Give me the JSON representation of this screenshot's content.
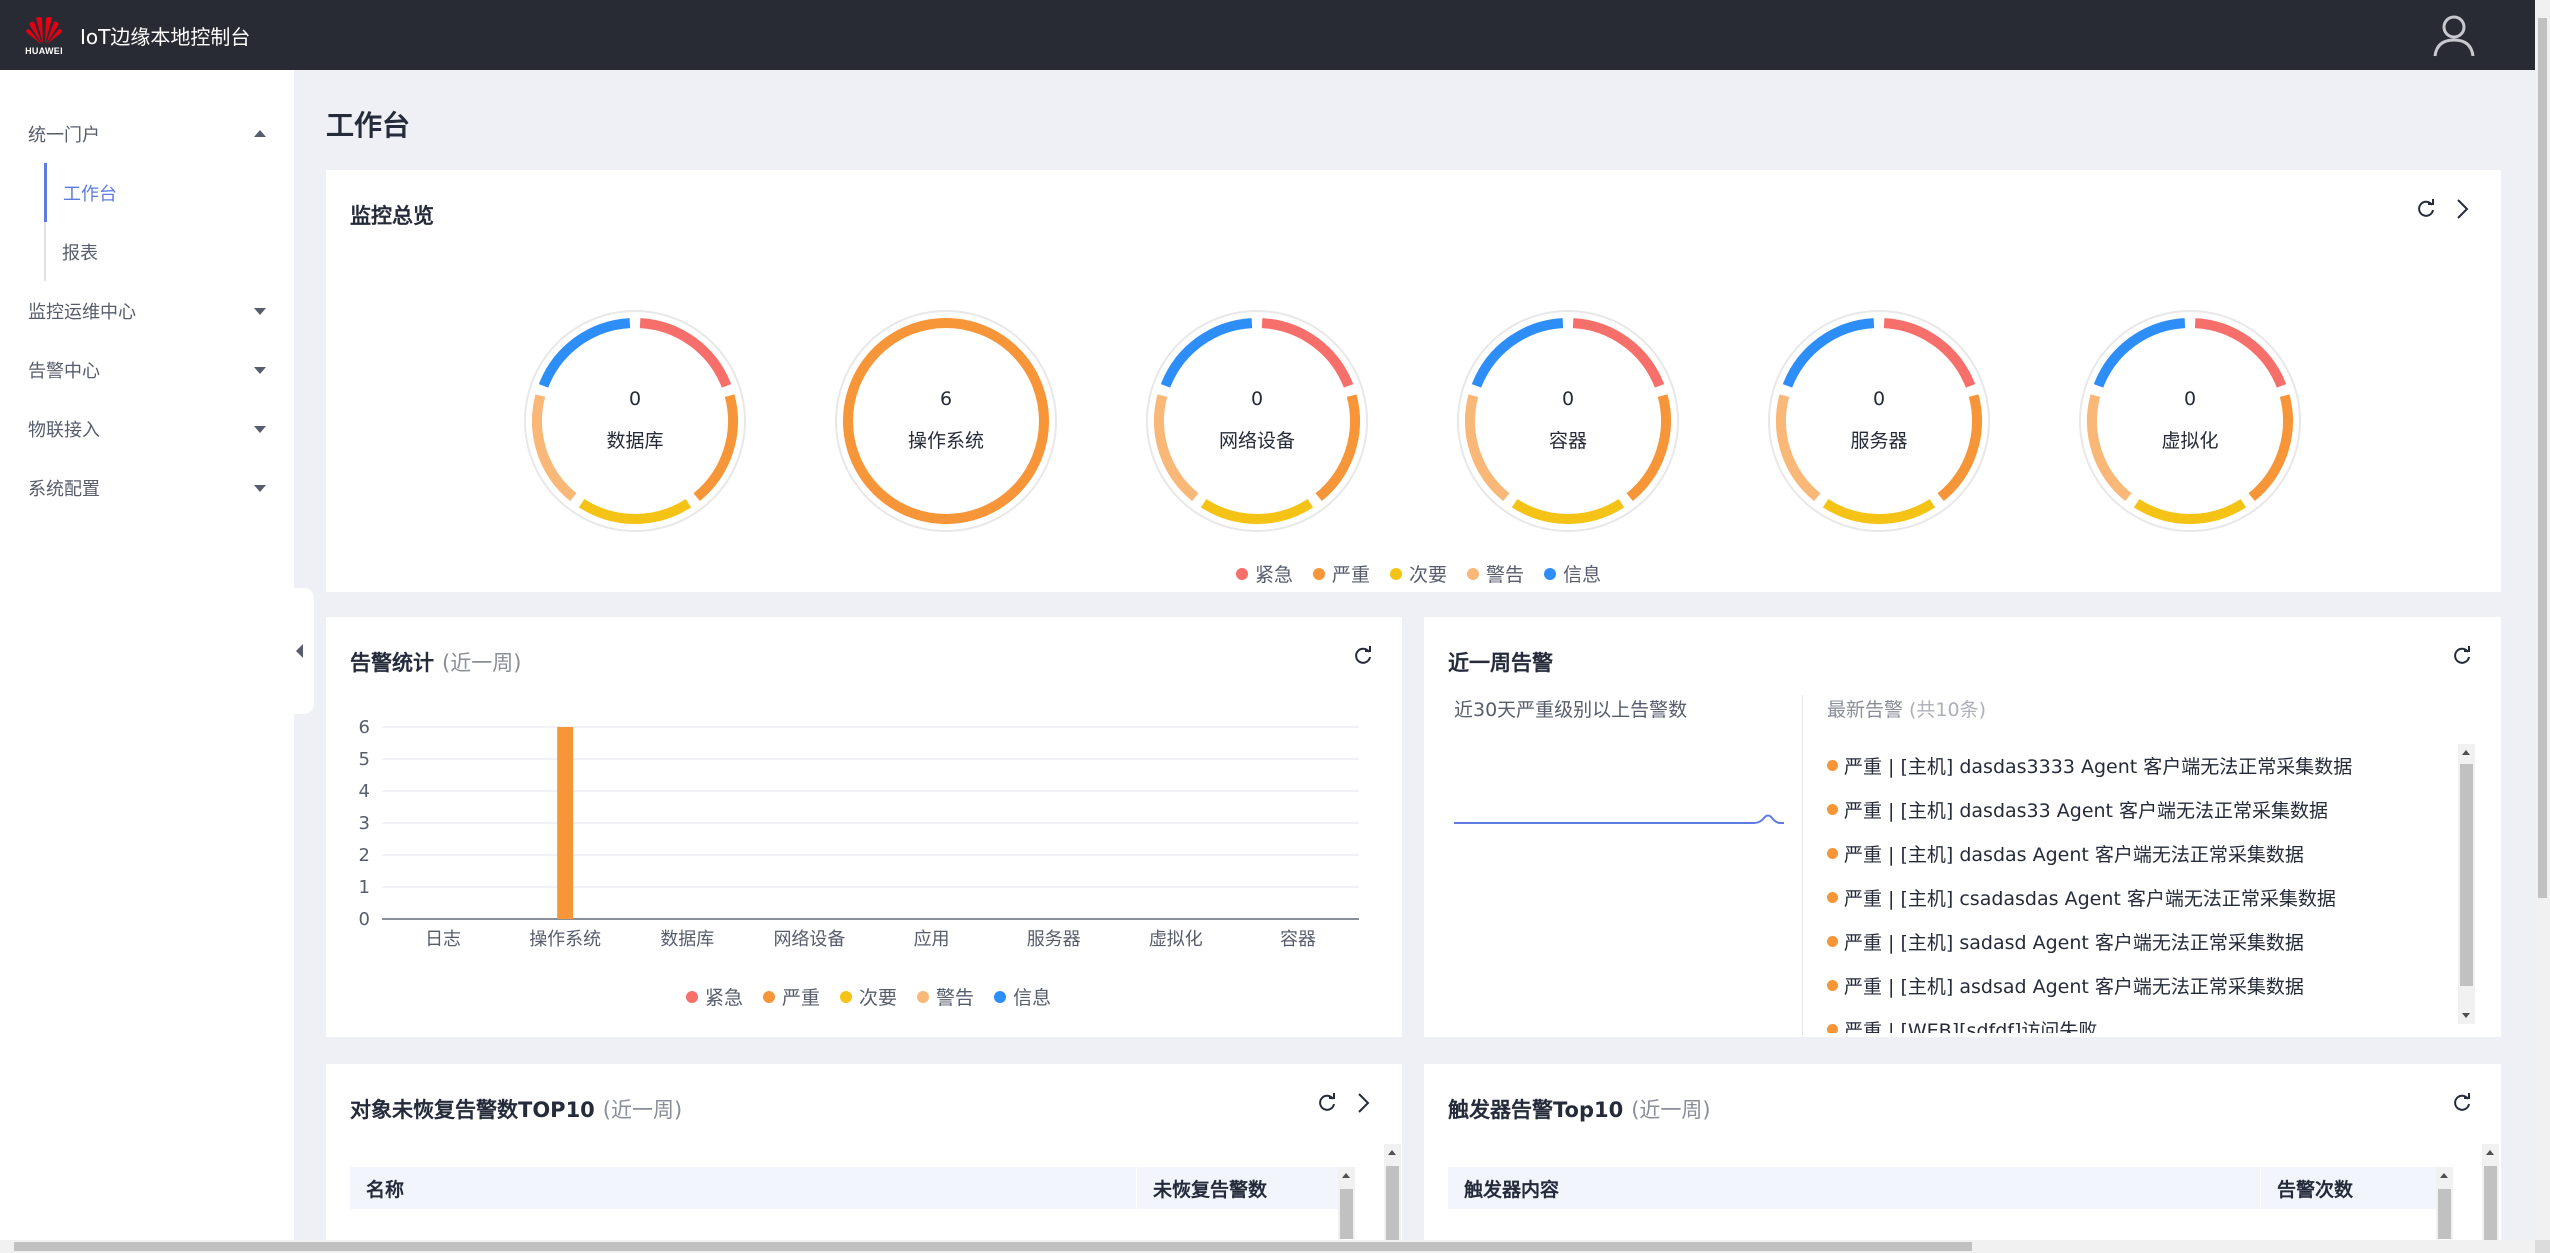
{
  "header": {
    "logo_text": "HUAWEI",
    "app_title": "IoT边缘本地控制台",
    "user_icon": "user-icon"
  },
  "sidebar": {
    "groups": [
      {
        "label": "统一门户",
        "expanded": true,
        "items": [
          {
            "label": "工作台",
            "active": true
          },
          {
            "label": "报表",
            "active": false
          }
        ]
      },
      {
        "label": "监控运维中心",
        "expanded": false
      },
      {
        "label": "告警中心",
        "expanded": false
      },
      {
        "label": "物联接入",
        "expanded": false
      },
      {
        "label": "系统配置",
        "expanded": false
      }
    ]
  },
  "page": {
    "title": "工作台"
  },
  "colors": {
    "urgent": "#f66f6a",
    "severe": "#f79539",
    "minor": "#f5c316",
    "warning": "#f9b778",
    "info": "#2e8ef7",
    "accent": "#5e7ce0",
    "bar": "#f79539"
  },
  "severity_legend": [
    "紧急",
    "严重",
    "次要",
    "警告",
    "信息"
  ],
  "monitor_overview": {
    "title": "监控总览",
    "donuts": [
      {
        "value": "0",
        "label": "数据库",
        "mode": "empty"
      },
      {
        "value": "6",
        "label": "操作系统",
        "mode": "severe"
      },
      {
        "value": "0",
        "label": "网络设备",
        "mode": "empty"
      },
      {
        "value": "0",
        "label": "容器",
        "mode": "empty"
      },
      {
        "value": "0",
        "label": "服务器",
        "mode": "empty"
      },
      {
        "value": "0",
        "label": "虚拟化",
        "mode": "empty"
      }
    ]
  },
  "alarm_stats": {
    "title": "告警统计",
    "subtitle": "(近一周)"
  },
  "chart_data": {
    "type": "bar",
    "categories": [
      "日志",
      "操作系统",
      "数据库",
      "网络设备",
      "应用",
      "服务器",
      "虚拟化",
      "容器"
    ],
    "series": [
      {
        "name": "紧急",
        "values": [
          0,
          0,
          0,
          0,
          0,
          0,
          0,
          0
        ]
      },
      {
        "name": "严重",
        "values": [
          0,
          6,
          0,
          0,
          0,
          0,
          0,
          0
        ]
      },
      {
        "name": "次要",
        "values": [
          0,
          0,
          0,
          0,
          0,
          0,
          0,
          0
        ]
      },
      {
        "name": "警告",
        "values": [
          0,
          0,
          0,
          0,
          0,
          0,
          0,
          0
        ]
      },
      {
        "name": "信息",
        "values": [
          0,
          0,
          0,
          0,
          0,
          0,
          0,
          0
        ]
      }
    ],
    "yticks": [
      0,
      1,
      2,
      3,
      4,
      5,
      6
    ],
    "ylim": [
      0,
      6
    ],
    "grid": true,
    "legend": "bottom"
  },
  "recent_week": {
    "title": "近一周告警",
    "left_label": "近30天严重级别以上告警数",
    "latest_label": "最新告警",
    "latest_count": "(共10条)",
    "alarms": [
      "严重 | [主机] dasdas3333 Agent 客户端无法正常采集数据",
      "严重 | [主机] dasdas33 Agent 客户端无法正常采集数据",
      "严重 | [主机] dasdas Agent 客户端无法正常采集数据",
      "严重 | [主机] csadasdas Agent 客户端无法正常采集数据",
      "严重 | [主机] sadasd Agent 客户端无法正常采集数据",
      "严重 | [主机] asdsad Agent 客户端无法正常采集数据",
      "严重 | [WEB][sdfdf]访问失败"
    ]
  },
  "top10_objects": {
    "title": "对象未恢复告警数TOP10",
    "subtitle": "(近一周)",
    "columns": [
      "名称",
      "未恢复告警数"
    ]
  },
  "trigger_top10": {
    "title": "触发器告警Top10",
    "subtitle": "(近一周)",
    "columns": [
      "触发器内容",
      "告警次数"
    ]
  }
}
